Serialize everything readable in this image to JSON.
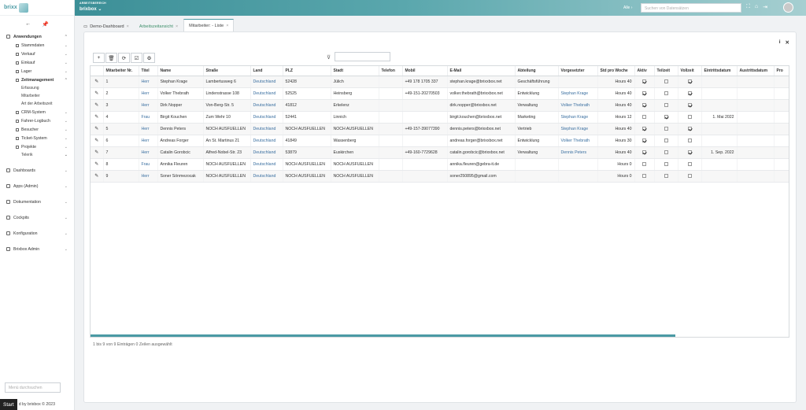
{
  "brand": {
    "name": "brixx"
  },
  "topbar": {
    "workspace_label": "ARBEITSBEREICH",
    "workspace_value": "brixbox ⌄",
    "scope": "Alle ›",
    "search_placeholder": "Suchen von Datensätzen"
  },
  "sidebar": {
    "items": [
      {
        "label": "Anwendungen",
        "level": 0,
        "bold": true,
        "expanded": true
      },
      {
        "label": "Stammdaten",
        "level": 1
      },
      {
        "label": "Verkauf",
        "level": 1
      },
      {
        "label": "Einkauf",
        "level": 1
      },
      {
        "label": "Lager",
        "level": 1
      },
      {
        "label": "Zeitmanagement",
        "level": 1,
        "bold": true,
        "expanded": true
      },
      {
        "label": "Erfassung",
        "level": 2
      },
      {
        "label": "Mitarbeiter",
        "level": 2
      },
      {
        "label": "Art der Arbeitszeit",
        "level": 2
      },
      {
        "label": "CRM-System",
        "level": 1
      },
      {
        "label": "Fahrer-Logbuch",
        "level": 1
      },
      {
        "label": "Besucher",
        "level": 1
      },
      {
        "label": "Ticket-System",
        "level": 1
      },
      {
        "label": "Projekte",
        "level": 1
      },
      {
        "label": "Telerik",
        "level": 2,
        "chevron": true
      },
      {
        "label": "Dashboards",
        "level": 0,
        "gap": true
      },
      {
        "label": "Apps (Admin)",
        "level": 0,
        "gap": true
      },
      {
        "label": "Dokumentation",
        "level": 0,
        "gap": true
      },
      {
        "label": "Cockpits",
        "level": 0,
        "gap": true
      },
      {
        "label": "Konfiguration",
        "level": 0,
        "gap": true
      },
      {
        "label": "Brixbox Admin",
        "level": 0,
        "gap": true
      }
    ],
    "menu_search_placeholder": "Menü durchsuchen",
    "footer": "d by brixbox © 2023",
    "start_label": "Start"
  },
  "tabs": [
    {
      "label": "Demo-Dashboard",
      "active": false,
      "icon": "dashboard-icon"
    },
    {
      "label": "Arbeitszeitansicht",
      "active": false,
      "green": true
    },
    {
      "label": "Mitarbeiter: - Liste",
      "active": true
    }
  ],
  "grid": {
    "columns": [
      {
        "key": "edit",
        "label": "",
        "w": 16
      },
      {
        "key": "nr",
        "label": "Mitarbeiter Nr.",
        "w": 45
      },
      {
        "key": "titel",
        "label": "Titel",
        "w": 24
      },
      {
        "key": "name",
        "label": "Name",
        "w": 58
      },
      {
        "key": "strasse",
        "label": "Straße",
        "w": 60
      },
      {
        "key": "land",
        "label": "Land",
        "w": 41
      },
      {
        "key": "plz",
        "label": "PLZ",
        "w": 61
      },
      {
        "key": "stadt",
        "label": "Stadt",
        "w": 61
      },
      {
        "key": "telefon",
        "label": "Telefon",
        "w": 30
      },
      {
        "key": "mobil",
        "label": "Mobil",
        "w": 57
      },
      {
        "key": "email",
        "label": "E-Mail",
        "w": 86
      },
      {
        "key": "abteilung",
        "label": "Abteilung",
        "w": 55
      },
      {
        "key": "vorgesetzter",
        "label": "Vorgesetzter",
        "w": 50
      },
      {
        "key": "std",
        "label": "Std pro Woche",
        "w": 47
      },
      {
        "key": "aktiv",
        "label": "Aktiv",
        "w": 25
      },
      {
        "key": "teilzeit",
        "label": "Teilzeit",
        "w": 30
      },
      {
        "key": "vollzeit",
        "label": "Vollzeit",
        "w": 30
      },
      {
        "key": "eintritt",
        "label": "Eintrittsdatum",
        "w": 45
      },
      {
        "key": "austritt",
        "label": "Austrittsdatum",
        "w": 47
      },
      {
        "key": "pro",
        "label": "Pro",
        "w": 21
      }
    ],
    "rows": [
      {
        "nr": "1",
        "titel": "Herr",
        "name": "Stephan Krage",
        "strasse": "Lambertusweg 6",
        "land": "Deutschland",
        "plz": "52428",
        "stadt": "Jülich",
        "telefon": "",
        "mobil": "+49 178 1705 337",
        "email": "stephan.krage@brixxbox.net",
        "abteilung": "Geschäftsführung",
        "vorgesetzter": "",
        "std": "Hours 40",
        "aktiv": true,
        "teilzeit": false,
        "vollzeit": true,
        "eintritt": "",
        "austritt": "",
        "pro": ""
      },
      {
        "nr": "2",
        "titel": "Herr",
        "name": "Volker Thebrath",
        "strasse": "Lindenstrasse 108",
        "land": "Deutschland",
        "plz": "52525",
        "stadt": "Heinsberg",
        "telefon": "",
        "mobil": "+49-151-20270503",
        "email": "volker.thebrath@brixxbox.net",
        "abteilung": "Entwicklung",
        "vorgesetzter": "Stephan Krage",
        "std": "Hours 40",
        "aktiv": true,
        "teilzeit": false,
        "vollzeit": true,
        "eintritt": "",
        "austritt": "",
        "pro": ""
      },
      {
        "nr": "3",
        "titel": "Herr",
        "name": "Dirk Nopper",
        "strasse": "Von-Berg-Str. 5",
        "land": "Deutschland",
        "plz": "41812",
        "stadt": "Erkelenz",
        "telefon": "",
        "mobil": "",
        "email": "dirk.nopper@brixxbox.net",
        "abteilung": "Verwaltung",
        "vorgesetzter": "Volker Thebrath",
        "std": "Hours 40",
        "aktiv": true,
        "teilzeit": false,
        "vollzeit": true,
        "eintritt": "",
        "austritt": "",
        "pro": ""
      },
      {
        "nr": "4",
        "titel": "Frau",
        "name": "Birgit Kouchen",
        "strasse": "Zum Wehr 10",
        "land": "Deutschland",
        "plz": "52441",
        "stadt": "Linnich",
        "telefon": "",
        "mobil": "",
        "email": "birgit.kouchen@brixxbox.net",
        "abteilung": "Marketing",
        "vorgesetzter": "Stephan Krage",
        "std": "Hours 12",
        "aktiv": false,
        "teilzeit": true,
        "vollzeit": false,
        "eintritt": "1. Mai 2022",
        "austritt": "",
        "pro": ""
      },
      {
        "nr": "5",
        "titel": "Herr",
        "name": "Dennis Peters",
        "strasse": "NOCH AUSFUELLEN",
        "land": "Deutschland",
        "plz": "NOCH AUSFUELLEN",
        "stadt": "NOCH AUSFUELLEN",
        "telefon": "",
        "mobil": "+49-157-39077390",
        "email": "dennis.peters@brixxbox.net",
        "abteilung": "Vertrieb",
        "vorgesetzter": "Stephan Krage",
        "std": "Hours 40",
        "aktiv": true,
        "teilzeit": false,
        "vollzeit": true,
        "eintritt": "",
        "austritt": "",
        "pro": ""
      },
      {
        "nr": "6",
        "titel": "Herr",
        "name": "Andreas Forger",
        "strasse": "An St. Martinus 21",
        "land": "Deutschland",
        "plz": "41849",
        "stadt": "Wassenberg",
        "telefon": "",
        "mobil": "",
        "email": "andreas.forger@brixxbox.net",
        "abteilung": "Entwicklung",
        "vorgesetzter": "Volker Thebrath",
        "std": "Hours 30",
        "aktiv": true,
        "teilzeit": false,
        "vollzeit": false,
        "eintritt": "",
        "austritt": "",
        "pro": ""
      },
      {
        "nr": "7",
        "titel": "Herr",
        "name": "Catalin Gorobcic",
        "strasse": "Alfred-Nobel-Str. 23",
        "land": "Deutschland",
        "plz": "53879",
        "stadt": "Euskirchen",
        "telefon": "",
        "mobil": "+49-160-7729628",
        "email": "catalin.gorobcic@brixxbox.net",
        "abteilung": "Verwaltung",
        "vorgesetzter": "Dennis Peters",
        "std": "Hours 40",
        "aktiv": true,
        "teilzeit": false,
        "vollzeit": true,
        "eintritt": "1. Sep. 2022",
        "austritt": "",
        "pro": ""
      },
      {
        "nr": "8",
        "titel": "Frau",
        "name": "Annika Fleuren",
        "strasse": "NOCH AUSFUELLEN",
        "land": "Deutschland",
        "plz": "NOCH AUSFUELLEN",
        "stadt": "NOCH AUSFUELLEN",
        "telefon": "",
        "mobil": "",
        "email": "annika.fleuren@gebra-it.de",
        "abteilung": "",
        "vorgesetzter": "",
        "std": "Hours 0",
        "aktiv": false,
        "teilzeit": false,
        "vollzeit": false,
        "eintritt": "",
        "austritt": "",
        "pro": ""
      },
      {
        "nr": "9",
        "titel": "Herr",
        "name": "Soner Sönmezocak",
        "strasse": "NOCH AUSFUELLEN",
        "land": "Deutschland",
        "plz": "NOCH AUSFUELLEN",
        "stadt": "NOCH AUSFUELLEN",
        "telefon": "",
        "mobil": "",
        "email": "soner250895@gmail.com",
        "abteilung": "",
        "vorgesetzter": "",
        "std": "Hours 0",
        "aktiv": false,
        "teilzeit": false,
        "vollzeit": false,
        "eintritt": "",
        "austritt": "",
        "pro": ""
      }
    ],
    "status": "1 bis 9 von 9 Einträgen   0 Zeilen ausgewählt"
  },
  "toolbar": {
    "buttons": [
      {
        "name": "add-button",
        "glyph": "+"
      },
      {
        "name": "delete-button",
        "glyph": "🗑"
      },
      {
        "name": "refresh-button",
        "glyph": "⟳"
      },
      {
        "name": "select-all-button",
        "glyph": "☑"
      },
      {
        "name": "settings-button",
        "glyph": "⚙"
      }
    ]
  },
  "colors": {
    "accent": "#4a9aa4",
    "link": "#3a6fa0"
  }
}
